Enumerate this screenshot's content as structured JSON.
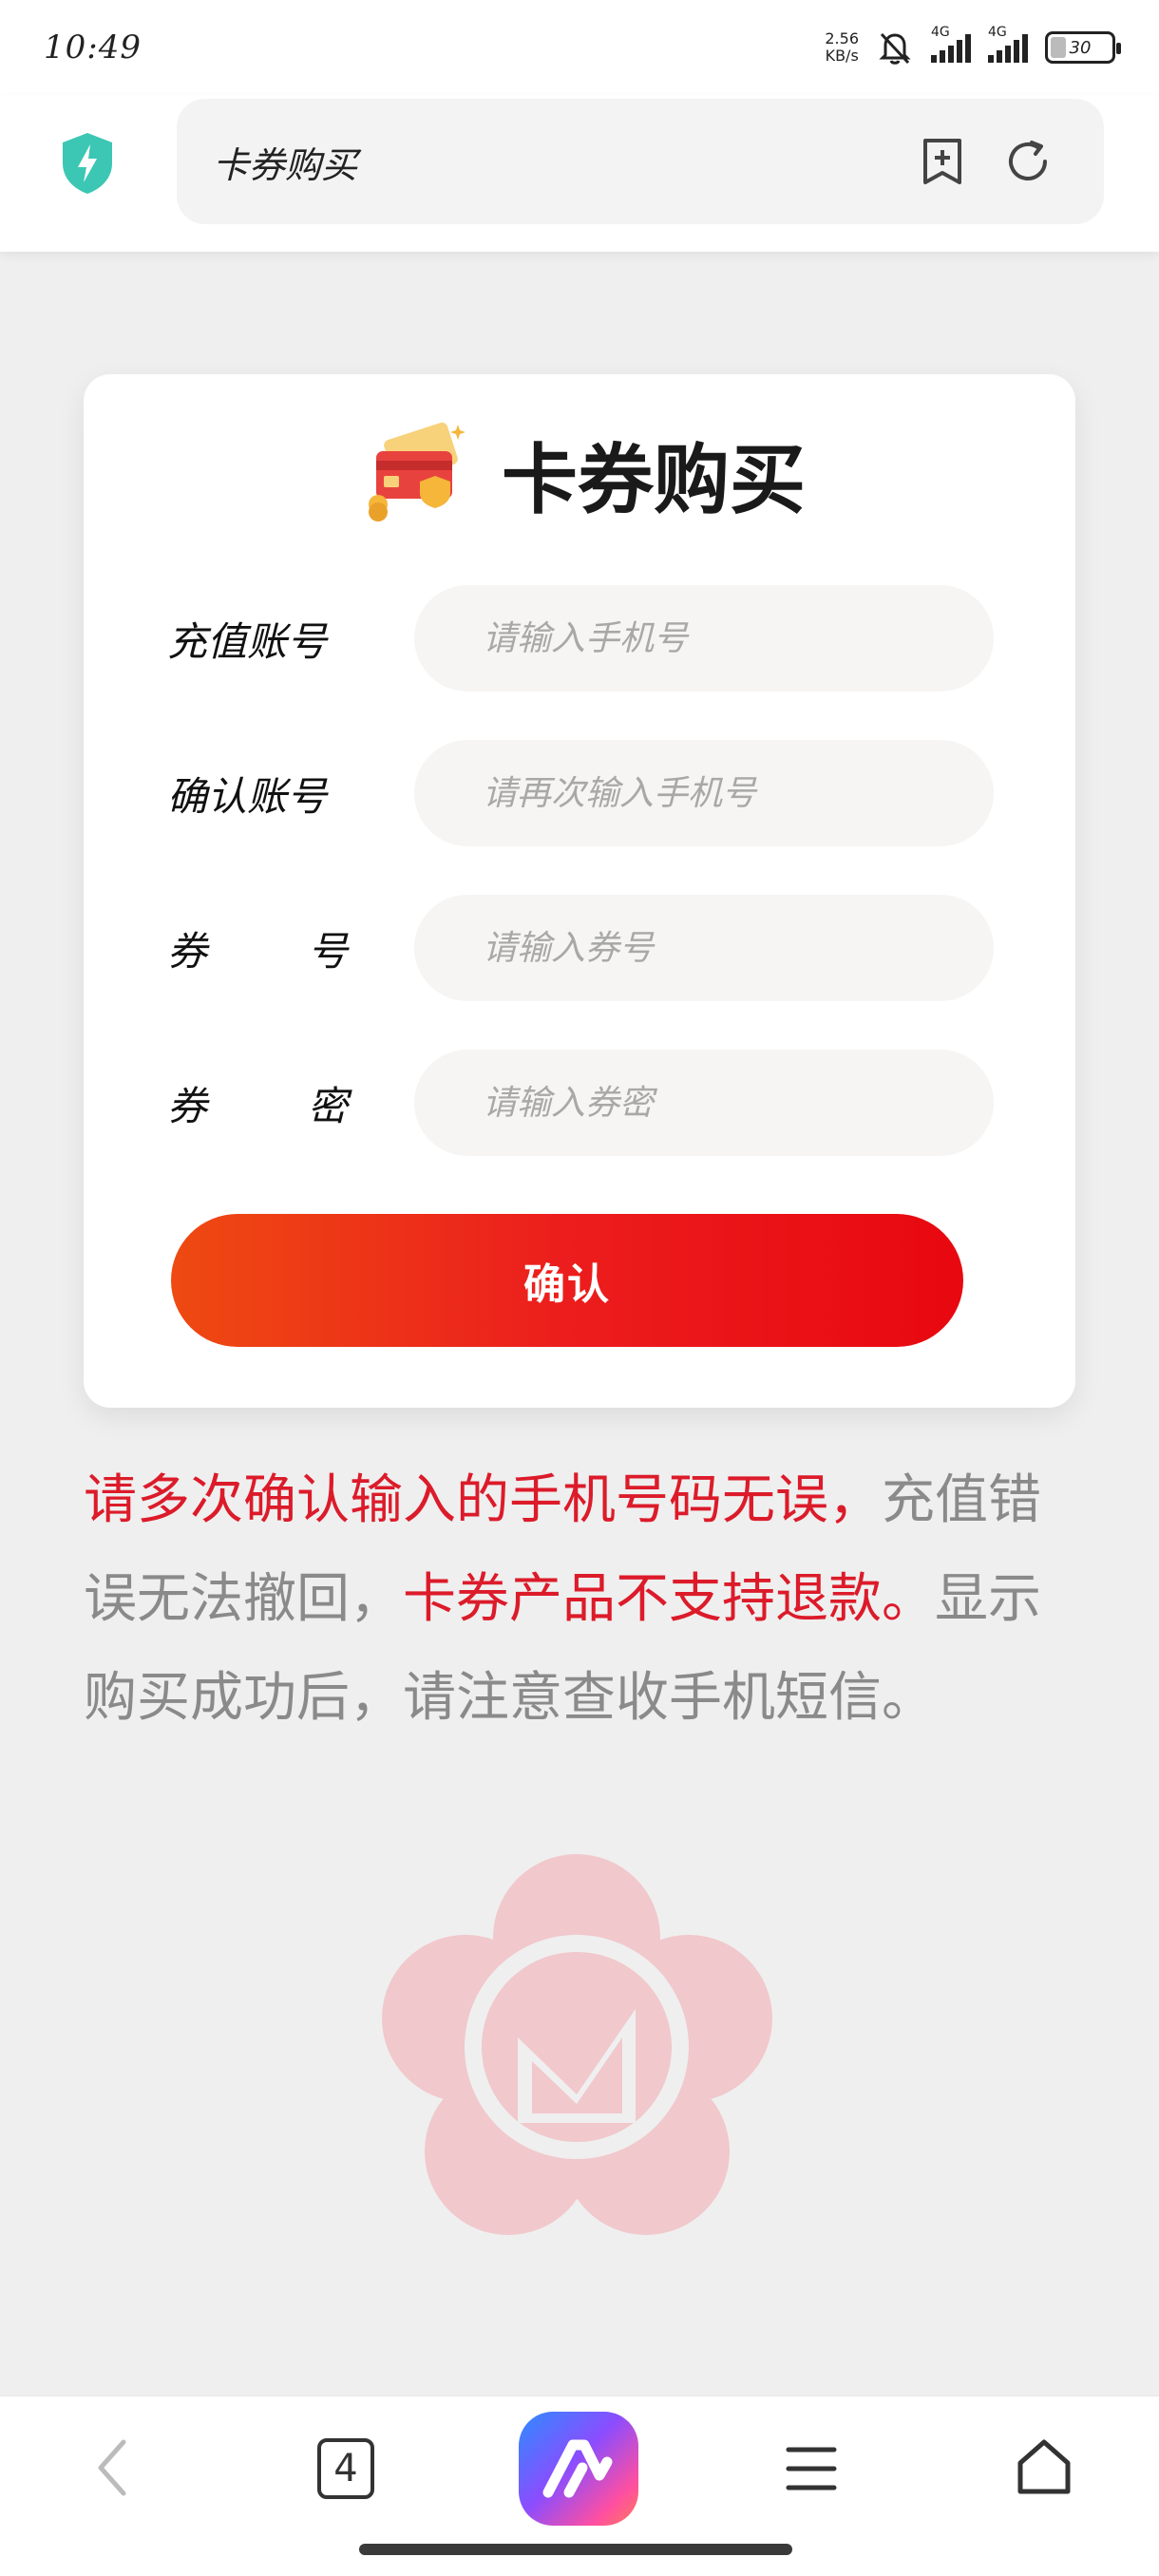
{
  "status_bar": {
    "time": "10:49",
    "net_speed": "2.56",
    "net_speed_unit": "KB/s",
    "signal_1_tag": "4G",
    "signal_2_tag": "4G",
    "battery": "30",
    "icons": [
      "bell-off-icon",
      "signal-icon",
      "signal-icon",
      "battery-icon"
    ]
  },
  "browser": {
    "url_title": "卡券购买",
    "icons": [
      "shield-bolt-icon",
      "bookmark-add-icon",
      "reload-icon"
    ],
    "shield_color": "#3cc7b4"
  },
  "card": {
    "title": "卡券购买",
    "fields": [
      {
        "label_a": "充值账号",
        "label_b": "",
        "placeholder": "请输入手机号"
      },
      {
        "label_a": "确认账号",
        "label_b": "",
        "placeholder": "请再次输入手机号"
      },
      {
        "label_a": "券",
        "label_b": "号",
        "placeholder": "请输入券号"
      },
      {
        "label_a": "券",
        "label_b": "密",
        "placeholder": "请输入券密"
      }
    ],
    "confirm_label": "确认"
  },
  "notice": {
    "part1_red": "请多次确认输入的手机号码无误，",
    "part2_gray": "充值错误无法撤回，",
    "part3_red": "卡券产品不支持退款。",
    "part4_gray": "显示购买成功后，请注意查收手机短信。"
  },
  "bottom_nav": {
    "tab_count": "4",
    "icons": [
      "back-icon",
      "tabs-icon",
      "ai-assistant-icon",
      "menu-icon",
      "home-icon"
    ]
  },
  "colors": {
    "accent_red": "#dc1b2a",
    "button_gradient_start": "#ee4a12",
    "button_gradient_end": "#e8080f"
  }
}
